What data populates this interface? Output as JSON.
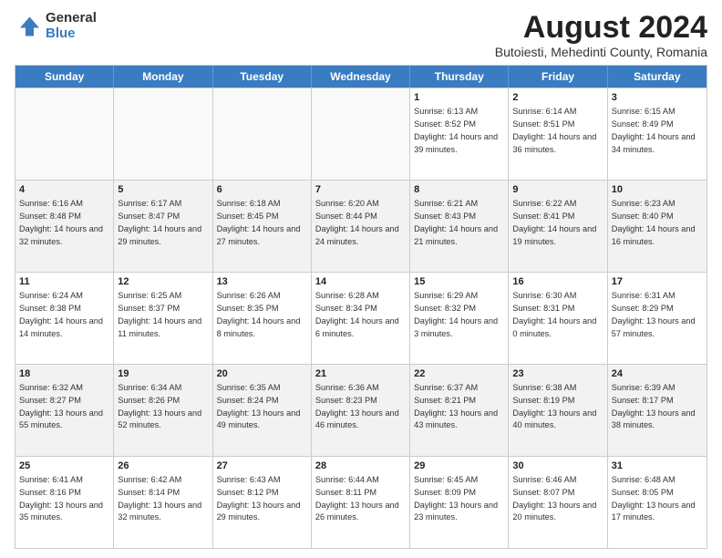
{
  "logo": {
    "general": "General",
    "blue": "Blue"
  },
  "title": "August 2024",
  "subtitle": "Butoiesti, Mehedinti County, Romania",
  "headers": [
    "Sunday",
    "Monday",
    "Tuesday",
    "Wednesday",
    "Thursday",
    "Friday",
    "Saturday"
  ],
  "rows": [
    [
      {
        "day": "",
        "text": "",
        "empty": true
      },
      {
        "day": "",
        "text": "",
        "empty": true
      },
      {
        "day": "",
        "text": "",
        "empty": true
      },
      {
        "day": "",
        "text": "",
        "empty": true
      },
      {
        "day": "1",
        "text": "Sunrise: 6:13 AM\nSunset: 8:52 PM\nDaylight: 14 hours and 39 minutes.",
        "empty": false
      },
      {
        "day": "2",
        "text": "Sunrise: 6:14 AM\nSunset: 8:51 PM\nDaylight: 14 hours and 36 minutes.",
        "empty": false
      },
      {
        "day": "3",
        "text": "Sunrise: 6:15 AM\nSunset: 8:49 PM\nDaylight: 14 hours and 34 minutes.",
        "empty": false
      }
    ],
    [
      {
        "day": "4",
        "text": "Sunrise: 6:16 AM\nSunset: 8:48 PM\nDaylight: 14 hours and 32 minutes.",
        "empty": false,
        "shaded": true
      },
      {
        "day": "5",
        "text": "Sunrise: 6:17 AM\nSunset: 8:47 PM\nDaylight: 14 hours and 29 minutes.",
        "empty": false,
        "shaded": true
      },
      {
        "day": "6",
        "text": "Sunrise: 6:18 AM\nSunset: 8:45 PM\nDaylight: 14 hours and 27 minutes.",
        "empty": false,
        "shaded": true
      },
      {
        "day": "7",
        "text": "Sunrise: 6:20 AM\nSunset: 8:44 PM\nDaylight: 14 hours and 24 minutes.",
        "empty": false,
        "shaded": true
      },
      {
        "day": "8",
        "text": "Sunrise: 6:21 AM\nSunset: 8:43 PM\nDaylight: 14 hours and 21 minutes.",
        "empty": false,
        "shaded": true
      },
      {
        "day": "9",
        "text": "Sunrise: 6:22 AM\nSunset: 8:41 PM\nDaylight: 14 hours and 19 minutes.",
        "empty": false,
        "shaded": true
      },
      {
        "day": "10",
        "text": "Sunrise: 6:23 AM\nSunset: 8:40 PM\nDaylight: 14 hours and 16 minutes.",
        "empty": false,
        "shaded": true
      }
    ],
    [
      {
        "day": "11",
        "text": "Sunrise: 6:24 AM\nSunset: 8:38 PM\nDaylight: 14 hours and 14 minutes.",
        "empty": false
      },
      {
        "day": "12",
        "text": "Sunrise: 6:25 AM\nSunset: 8:37 PM\nDaylight: 14 hours and 11 minutes.",
        "empty": false
      },
      {
        "day": "13",
        "text": "Sunrise: 6:26 AM\nSunset: 8:35 PM\nDaylight: 14 hours and 8 minutes.",
        "empty": false
      },
      {
        "day": "14",
        "text": "Sunrise: 6:28 AM\nSunset: 8:34 PM\nDaylight: 14 hours and 6 minutes.",
        "empty": false
      },
      {
        "day": "15",
        "text": "Sunrise: 6:29 AM\nSunset: 8:32 PM\nDaylight: 14 hours and 3 minutes.",
        "empty": false
      },
      {
        "day": "16",
        "text": "Sunrise: 6:30 AM\nSunset: 8:31 PM\nDaylight: 14 hours and 0 minutes.",
        "empty": false
      },
      {
        "day": "17",
        "text": "Sunrise: 6:31 AM\nSunset: 8:29 PM\nDaylight: 13 hours and 57 minutes.",
        "empty": false
      }
    ],
    [
      {
        "day": "18",
        "text": "Sunrise: 6:32 AM\nSunset: 8:27 PM\nDaylight: 13 hours and 55 minutes.",
        "empty": false,
        "shaded": true
      },
      {
        "day": "19",
        "text": "Sunrise: 6:34 AM\nSunset: 8:26 PM\nDaylight: 13 hours and 52 minutes.",
        "empty": false,
        "shaded": true
      },
      {
        "day": "20",
        "text": "Sunrise: 6:35 AM\nSunset: 8:24 PM\nDaylight: 13 hours and 49 minutes.",
        "empty": false,
        "shaded": true
      },
      {
        "day": "21",
        "text": "Sunrise: 6:36 AM\nSunset: 8:23 PM\nDaylight: 13 hours and 46 minutes.",
        "empty": false,
        "shaded": true
      },
      {
        "day": "22",
        "text": "Sunrise: 6:37 AM\nSunset: 8:21 PM\nDaylight: 13 hours and 43 minutes.",
        "empty": false,
        "shaded": true
      },
      {
        "day": "23",
        "text": "Sunrise: 6:38 AM\nSunset: 8:19 PM\nDaylight: 13 hours and 40 minutes.",
        "empty": false,
        "shaded": true
      },
      {
        "day": "24",
        "text": "Sunrise: 6:39 AM\nSunset: 8:17 PM\nDaylight: 13 hours and 38 minutes.",
        "empty": false,
        "shaded": true
      }
    ],
    [
      {
        "day": "25",
        "text": "Sunrise: 6:41 AM\nSunset: 8:16 PM\nDaylight: 13 hours and 35 minutes.",
        "empty": false
      },
      {
        "day": "26",
        "text": "Sunrise: 6:42 AM\nSunset: 8:14 PM\nDaylight: 13 hours and 32 minutes.",
        "empty": false
      },
      {
        "day": "27",
        "text": "Sunrise: 6:43 AM\nSunset: 8:12 PM\nDaylight: 13 hours and 29 minutes.",
        "empty": false
      },
      {
        "day": "28",
        "text": "Sunrise: 6:44 AM\nSunset: 8:11 PM\nDaylight: 13 hours and 26 minutes.",
        "empty": false
      },
      {
        "day": "29",
        "text": "Sunrise: 6:45 AM\nSunset: 8:09 PM\nDaylight: 13 hours and 23 minutes.",
        "empty": false
      },
      {
        "day": "30",
        "text": "Sunrise: 6:46 AM\nSunset: 8:07 PM\nDaylight: 13 hours and 20 minutes.",
        "empty": false
      },
      {
        "day": "31",
        "text": "Sunrise: 6:48 AM\nSunset: 8:05 PM\nDaylight: 13 hours and 17 minutes.",
        "empty": false
      }
    ]
  ]
}
